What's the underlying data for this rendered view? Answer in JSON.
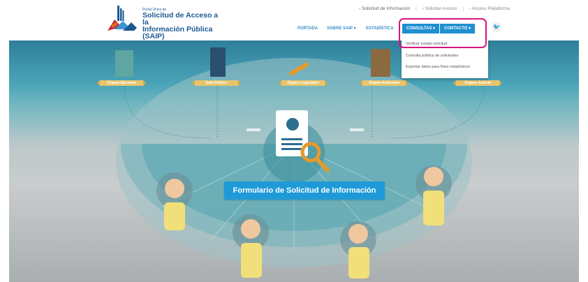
{
  "brand": {
    "small": "Portal Único de",
    "title_line1": "Solicitud de Acceso a la",
    "title_line2": "Información Pública (SAIP)"
  },
  "top_links": [
    "› Solicitud de Información",
    "› Solicitar Acceso",
    "› Acceso Plataforma"
  ],
  "nav": {
    "portada": "PORTADA",
    "sobre_saip": "SOBRE SAIP ▾",
    "estadistica": "ESTADÍSTICA",
    "consultas": "CONSULTAS ▾",
    "contacto": "CONTACTO ▾"
  },
  "twitter_glyph": "🐦",
  "dropdown_items": [
    "Verificar estado solicitud",
    "Consulta pública de solicitudes",
    "Exportar datos para fines estadísticos"
  ],
  "organs": [
    "Órgano Ejecutivo",
    "Ente Público",
    "Órgano Legislativo",
    "Órgano Autónomo",
    "Órgano Judicial"
  ],
  "cta_label": "Formulario de Solicitud de Información",
  "colors": {
    "accent": "#1f9ad8",
    "highlight": "#d9157f",
    "ribbon": "#e8c56d"
  }
}
